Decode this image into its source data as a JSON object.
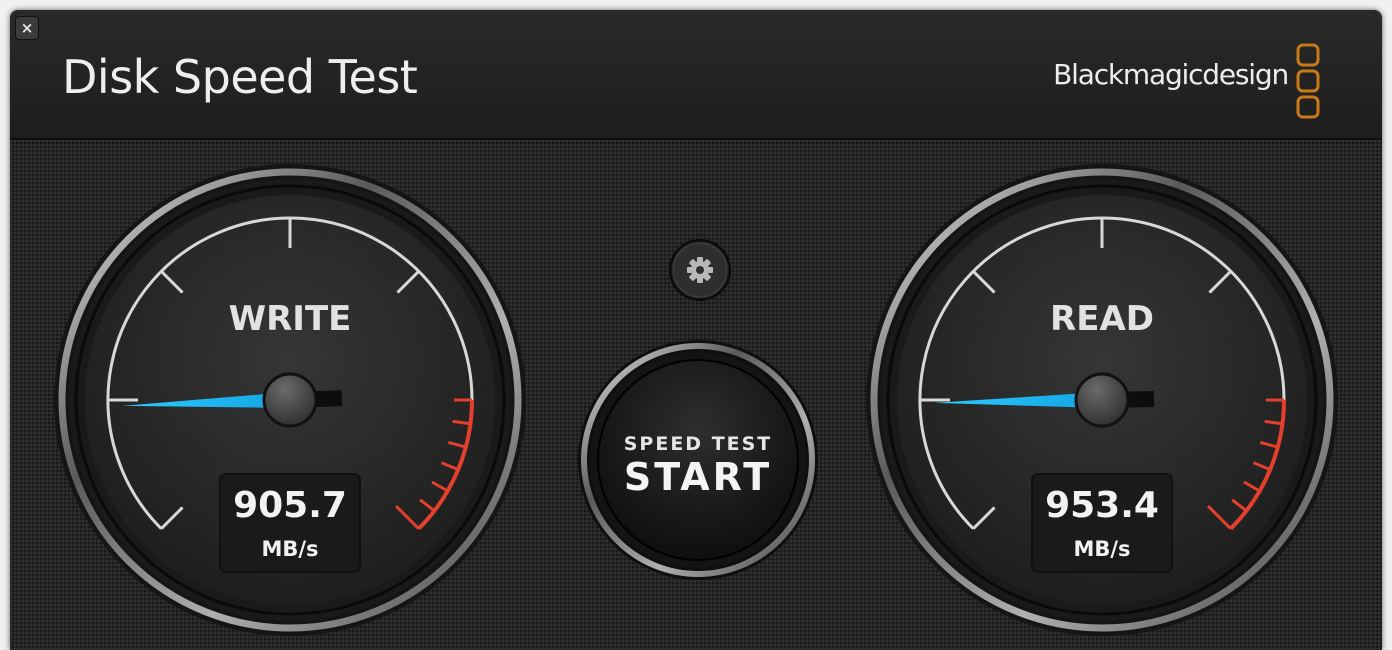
{
  "window": {
    "title": "Disk Speed Test",
    "close_glyph": "×"
  },
  "brand": {
    "name": "Blackmagicdesign",
    "logo": "three-stacked-squares-logo",
    "logo_color": "#c87a17"
  },
  "settings": {
    "icon": "gear-icon"
  },
  "start_button": {
    "caption": "SPEED TEST",
    "label": "START"
  },
  "gauges": {
    "write": {
      "label": "WRITE",
      "value": "905.7",
      "unit": "MB/s"
    },
    "read": {
      "label": "READ",
      "value": "953.4",
      "unit": "MB/s"
    }
  },
  "colors": {
    "needle": "#1fb6ee",
    "redline": "#e4412d",
    "tick": "#d8d8d8"
  }
}
